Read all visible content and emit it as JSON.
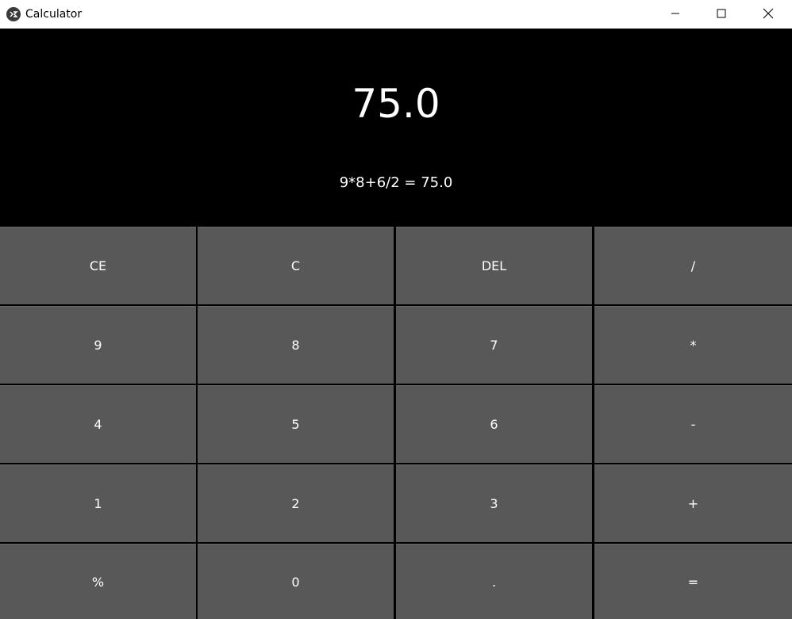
{
  "window": {
    "title": "Calculator",
    "icon": "kivy-app-icon",
    "controls": [
      "minimize-icon",
      "maximize-icon",
      "close-icon"
    ]
  },
  "display": {
    "result": "75.0",
    "expression": "9*8+6/2 = 75.0"
  },
  "keypad": {
    "rows": [
      [
        "CE",
        "C",
        "DEL",
        "/"
      ],
      [
        "9",
        "8",
        "7",
        "*"
      ],
      [
        "4",
        "5",
        "6",
        "-"
      ],
      [
        "1",
        "2",
        "3",
        "+"
      ],
      [
        "%",
        "0",
        ".",
        "="
      ]
    ]
  },
  "colors": {
    "background": "#000000",
    "button": "#585858",
    "text": "#ffffff",
    "titlebar": "#ffffff"
  }
}
